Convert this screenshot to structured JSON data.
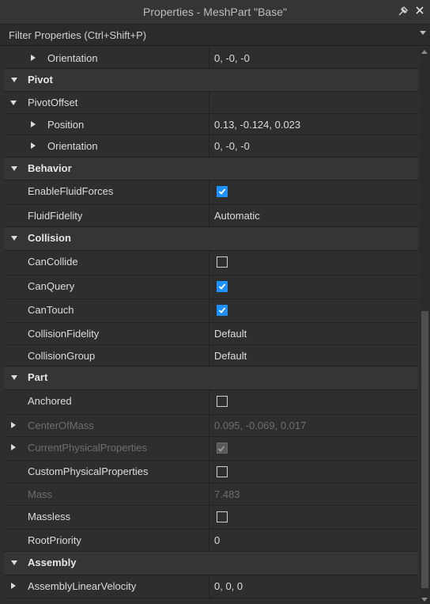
{
  "window": {
    "title": "Properties - MeshPart \"Base\"",
    "pin_icon": "pin-icon",
    "close_icon": "close-icon"
  },
  "filter": {
    "placeholder": "Filter Properties (Ctrl+Shift+P)"
  },
  "rows": [
    {
      "kind": "prop",
      "level": 2,
      "expand": "right",
      "label": "Orientation",
      "value": "0, -0, -0"
    },
    {
      "kind": "cat",
      "label": "Pivot"
    },
    {
      "kind": "prop",
      "level": 1,
      "expand": "down",
      "label": "PivotOffset",
      "value": ""
    },
    {
      "kind": "prop",
      "level": 2,
      "expand": "right",
      "label": "Position",
      "value": "0.13, -0.124, 0.023"
    },
    {
      "kind": "prop",
      "level": 2,
      "expand": "right",
      "label": "Orientation",
      "value": "0, -0, -0"
    },
    {
      "kind": "cat",
      "label": "Behavior"
    },
    {
      "kind": "prop",
      "level": 1,
      "label": "EnableFluidForces",
      "checkbox": true,
      "checked": true
    },
    {
      "kind": "prop",
      "level": 1,
      "label": "FluidFidelity",
      "value": "Automatic"
    },
    {
      "kind": "cat",
      "label": "Collision"
    },
    {
      "kind": "prop",
      "level": 1,
      "label": "CanCollide",
      "checkbox": true,
      "checked": false
    },
    {
      "kind": "prop",
      "level": 1,
      "label": "CanQuery",
      "checkbox": true,
      "checked": true
    },
    {
      "kind": "prop",
      "level": 1,
      "label": "CanTouch",
      "checkbox": true,
      "checked": true
    },
    {
      "kind": "prop",
      "level": 1,
      "label": "CollisionFidelity",
      "value": "Default"
    },
    {
      "kind": "prop",
      "level": 1,
      "label": "CollisionGroup",
      "value": "Default"
    },
    {
      "kind": "cat",
      "label": "Part"
    },
    {
      "kind": "prop",
      "level": 1,
      "label": "Anchored",
      "checkbox": true,
      "checked": false
    },
    {
      "kind": "prop",
      "level": 1,
      "expand": "right",
      "label": "CenterOfMass",
      "value": "0.095, -0.069, 0.017",
      "disabled": true
    },
    {
      "kind": "prop",
      "level": 1,
      "expand": "right",
      "label": "CurrentPhysicalProperties",
      "checkbox": true,
      "checked": true,
      "disabled": true
    },
    {
      "kind": "prop",
      "level": 1,
      "label": "CustomPhysicalProperties",
      "checkbox": true,
      "checked": false
    },
    {
      "kind": "prop",
      "level": 1,
      "label": "Mass",
      "value": "7.483",
      "disabled": true
    },
    {
      "kind": "prop",
      "level": 1,
      "label": "Massless",
      "checkbox": true,
      "checked": false
    },
    {
      "kind": "prop",
      "level": 1,
      "label": "RootPriority",
      "value": "0"
    },
    {
      "kind": "cat",
      "label": "Assembly"
    },
    {
      "kind": "prop",
      "level": 1,
      "expand": "right",
      "label": "AssemblyLinearVelocity",
      "value": "0, 0, 0"
    }
  ]
}
